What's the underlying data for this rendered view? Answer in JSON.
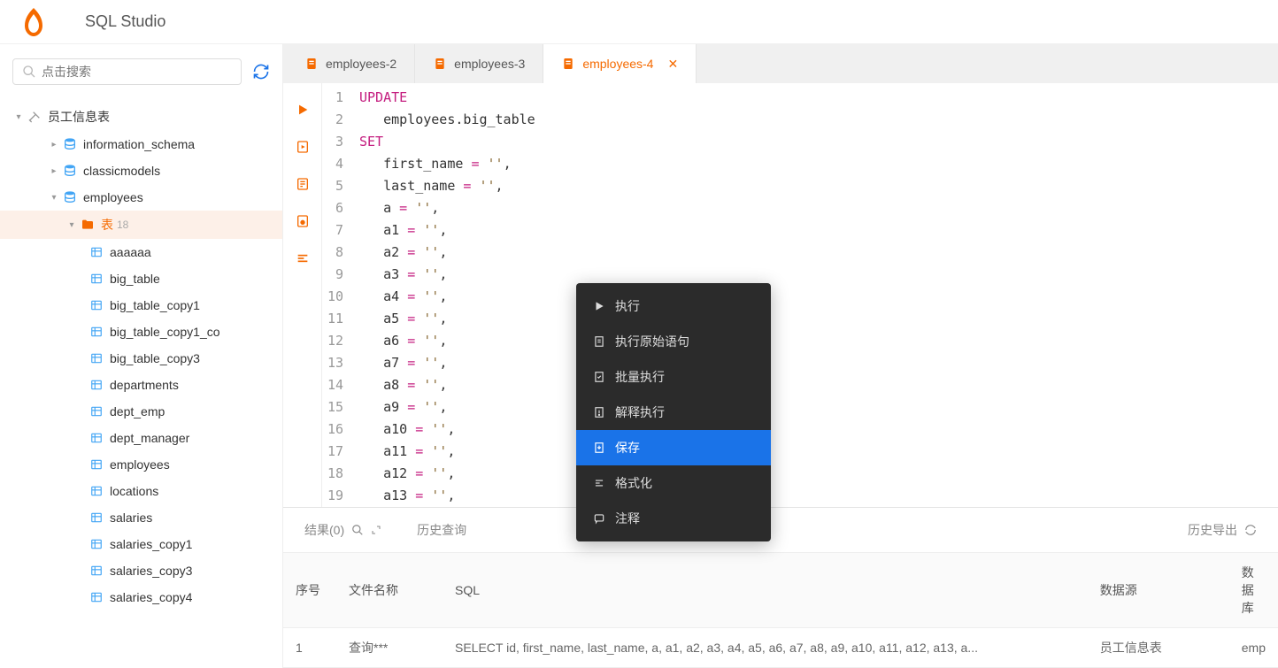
{
  "app": {
    "title": "SQL Studio"
  },
  "sidebar": {
    "search_placeholder": "点击搜索",
    "root": {
      "label": "员工信息表",
      "databases": [
        {
          "label": "information_schema"
        },
        {
          "label": "classicmodels"
        },
        {
          "label": "employees"
        }
      ],
      "tables_folder": {
        "label": "表",
        "count": "18"
      },
      "tables": [
        {
          "label": "aaaaaa"
        },
        {
          "label": "big_table"
        },
        {
          "label": "big_table_copy1"
        },
        {
          "label": "big_table_copy1_co"
        },
        {
          "label": "big_table_copy3"
        },
        {
          "label": "departments"
        },
        {
          "label": "dept_emp"
        },
        {
          "label": "dept_manager"
        },
        {
          "label": "employees"
        },
        {
          "label": "locations"
        },
        {
          "label": "salaries"
        },
        {
          "label": "salaries_copy1"
        },
        {
          "label": "salaries_copy3"
        },
        {
          "label": "salaries_copy4"
        }
      ]
    }
  },
  "tabs": [
    {
      "label": "employees-2"
    },
    {
      "label": "employees-3"
    },
    {
      "label": "employees-4"
    }
  ],
  "code": {
    "lines": [
      {
        "n": "1",
        "tokens": [
          {
            "t": "UPDATE",
            "c": "kw"
          }
        ]
      },
      {
        "n": "2",
        "tokens": [
          {
            "t": "   employees.big_table",
            "c": ""
          }
        ]
      },
      {
        "n": "3",
        "tokens": [
          {
            "t": "SET",
            "c": "kw"
          }
        ]
      },
      {
        "n": "4",
        "tokens": [
          {
            "t": "   first_name ",
            "c": ""
          },
          {
            "t": "=",
            "c": "op"
          },
          {
            "t": " ",
            "c": ""
          },
          {
            "t": "''",
            "c": "str"
          },
          {
            "t": ",",
            "c": ""
          }
        ]
      },
      {
        "n": "5",
        "tokens": [
          {
            "t": "   last_name ",
            "c": ""
          },
          {
            "t": "=",
            "c": "op"
          },
          {
            "t": " ",
            "c": ""
          },
          {
            "t": "''",
            "c": "str"
          },
          {
            "t": ",",
            "c": ""
          }
        ]
      },
      {
        "n": "6",
        "tokens": [
          {
            "t": "   a ",
            "c": ""
          },
          {
            "t": "=",
            "c": "op"
          },
          {
            "t": " ",
            "c": ""
          },
          {
            "t": "''",
            "c": "str"
          },
          {
            "t": ",",
            "c": ""
          }
        ]
      },
      {
        "n": "7",
        "tokens": [
          {
            "t": "   a1 ",
            "c": ""
          },
          {
            "t": "=",
            "c": "op"
          },
          {
            "t": " ",
            "c": ""
          },
          {
            "t": "''",
            "c": "str"
          },
          {
            "t": ",",
            "c": ""
          }
        ]
      },
      {
        "n": "8",
        "tokens": [
          {
            "t": "   a2 ",
            "c": ""
          },
          {
            "t": "=",
            "c": "op"
          },
          {
            "t": " ",
            "c": ""
          },
          {
            "t": "''",
            "c": "str"
          },
          {
            "t": ",",
            "c": ""
          }
        ]
      },
      {
        "n": "9",
        "tokens": [
          {
            "t": "   a3 ",
            "c": ""
          },
          {
            "t": "=",
            "c": "op"
          },
          {
            "t": " ",
            "c": ""
          },
          {
            "t": "''",
            "c": "str"
          },
          {
            "t": ",",
            "c": ""
          }
        ]
      },
      {
        "n": "10",
        "tokens": [
          {
            "t": "   a4 ",
            "c": ""
          },
          {
            "t": "=",
            "c": "op"
          },
          {
            "t": " ",
            "c": ""
          },
          {
            "t": "''",
            "c": "str"
          },
          {
            "t": ",",
            "c": ""
          }
        ]
      },
      {
        "n": "11",
        "tokens": [
          {
            "t": "   a5 ",
            "c": ""
          },
          {
            "t": "=",
            "c": "op"
          },
          {
            "t": " ",
            "c": ""
          },
          {
            "t": "''",
            "c": "str"
          },
          {
            "t": ",",
            "c": ""
          }
        ]
      },
      {
        "n": "12",
        "tokens": [
          {
            "t": "   a6 ",
            "c": ""
          },
          {
            "t": "=",
            "c": "op"
          },
          {
            "t": " ",
            "c": ""
          },
          {
            "t": "''",
            "c": "str"
          },
          {
            "t": ",",
            "c": ""
          }
        ]
      },
      {
        "n": "13",
        "tokens": [
          {
            "t": "   a7 ",
            "c": ""
          },
          {
            "t": "=",
            "c": "op"
          },
          {
            "t": " ",
            "c": ""
          },
          {
            "t": "''",
            "c": "str"
          },
          {
            "t": ",",
            "c": ""
          }
        ]
      },
      {
        "n": "14",
        "tokens": [
          {
            "t": "   a8 ",
            "c": ""
          },
          {
            "t": "=",
            "c": "op"
          },
          {
            "t": " ",
            "c": ""
          },
          {
            "t": "''",
            "c": "str"
          },
          {
            "t": ",",
            "c": ""
          }
        ]
      },
      {
        "n": "15",
        "tokens": [
          {
            "t": "   a9 ",
            "c": ""
          },
          {
            "t": "=",
            "c": "op"
          },
          {
            "t": " ",
            "c": ""
          },
          {
            "t": "''",
            "c": "str"
          },
          {
            "t": ",",
            "c": ""
          }
        ]
      },
      {
        "n": "16",
        "tokens": [
          {
            "t": "   a10 ",
            "c": ""
          },
          {
            "t": "=",
            "c": "op"
          },
          {
            "t": " ",
            "c": ""
          },
          {
            "t": "''",
            "c": "str"
          },
          {
            "t": ",",
            "c": ""
          }
        ]
      },
      {
        "n": "17",
        "tokens": [
          {
            "t": "   a11 ",
            "c": ""
          },
          {
            "t": "=",
            "c": "op"
          },
          {
            "t": " ",
            "c": ""
          },
          {
            "t": "''",
            "c": "str"
          },
          {
            "t": ",",
            "c": ""
          }
        ]
      },
      {
        "n": "18",
        "tokens": [
          {
            "t": "   a12 ",
            "c": ""
          },
          {
            "t": "=",
            "c": "op"
          },
          {
            "t": " ",
            "c": ""
          },
          {
            "t": "''",
            "c": "str"
          },
          {
            "t": ",",
            "c": ""
          }
        ]
      },
      {
        "n": "19",
        "tokens": [
          {
            "t": "   a13 ",
            "c": ""
          },
          {
            "t": "=",
            "c": "op"
          },
          {
            "t": " ",
            "c": ""
          },
          {
            "t": "''",
            "c": "str"
          },
          {
            "t": ",",
            "c": ""
          }
        ]
      }
    ]
  },
  "context_menu": {
    "items": [
      {
        "label": "执行",
        "icon": "play"
      },
      {
        "label": "执行原始语句",
        "icon": "doc"
      },
      {
        "label": "批量执行",
        "icon": "batch"
      },
      {
        "label": "解释执行",
        "icon": "explain"
      },
      {
        "label": "保存",
        "icon": "save",
        "highlighted": true
      },
      {
        "label": "格式化",
        "icon": "format"
      },
      {
        "label": "注释",
        "icon": "comment"
      }
    ]
  },
  "bottom": {
    "tabs": {
      "results": "结果(0)",
      "history_query": "历史查询",
      "history_export": "历史导出"
    },
    "table": {
      "headers": {
        "seq": "序号",
        "filename": "文件名称",
        "sql": "SQL",
        "datasource": "数据源",
        "database": "数据库"
      },
      "rows": [
        {
          "seq": "1",
          "filename": "查询***",
          "sql": "SELECT id, first_name, last_name, a, a1, a2, a3, a4, a5, a6, a7, a8, a9, a10, a11, a12, a13, a...",
          "datasource": "员工信息表",
          "database": "emp"
        }
      ]
    }
  }
}
